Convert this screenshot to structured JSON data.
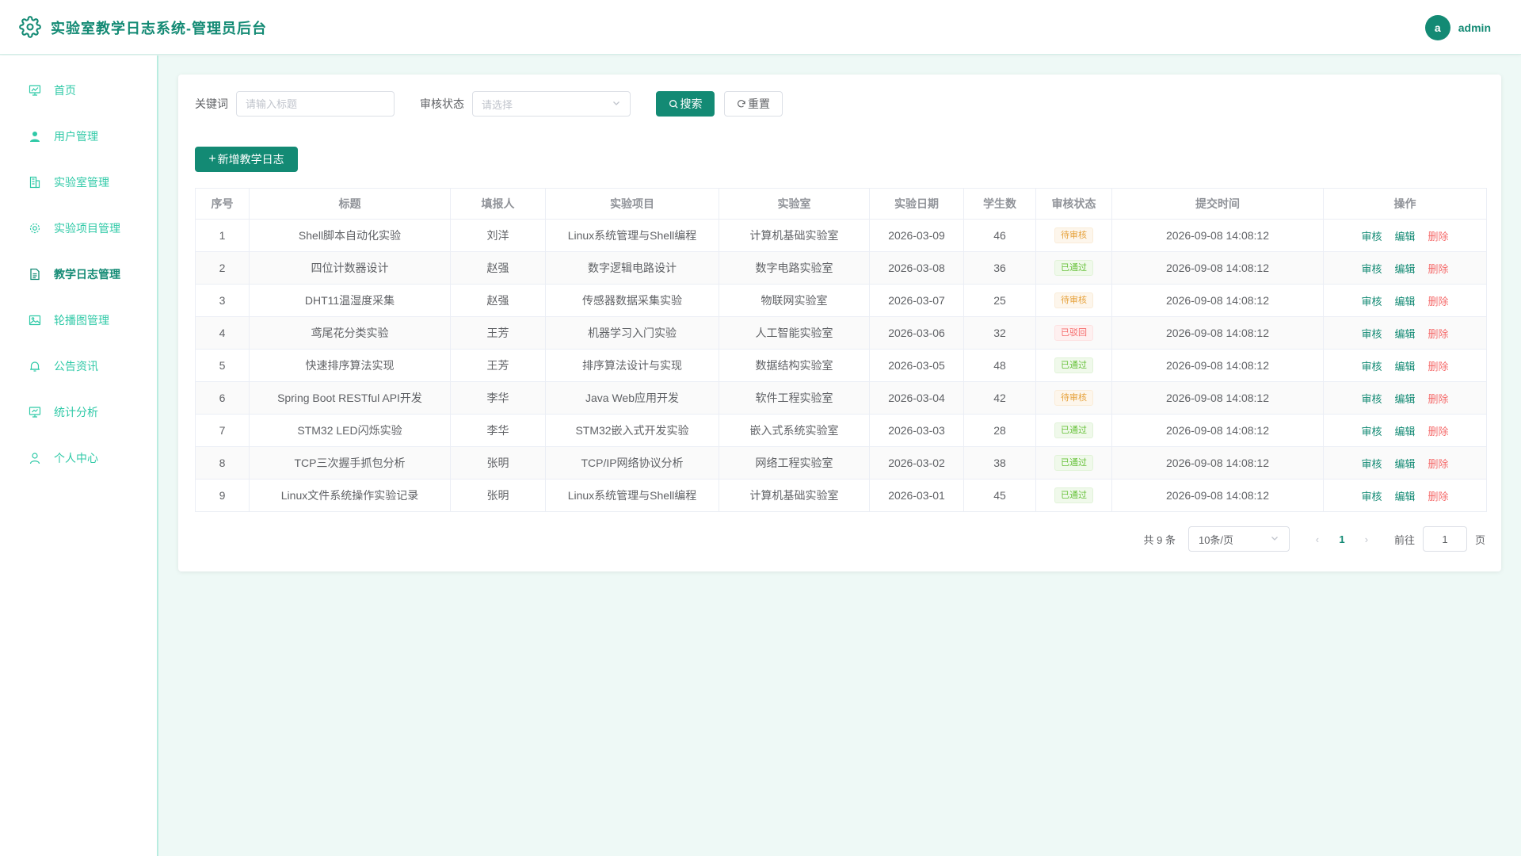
{
  "header": {
    "title": "实验室教学日志系统-管理员后台",
    "avatar_letter": "a",
    "username": "admin"
  },
  "sidebar": {
    "items": [
      {
        "label": "首页",
        "icon": "chart-icon",
        "active": false
      },
      {
        "label": "用户管理",
        "icon": "user-icon",
        "active": false
      },
      {
        "label": "实验室管理",
        "icon": "building-icon",
        "active": false
      },
      {
        "label": "实验项目管理",
        "icon": "gear-icon",
        "active": false
      },
      {
        "label": "教学日志管理",
        "icon": "document-icon",
        "active": true
      },
      {
        "label": "轮播图管理",
        "icon": "image-icon",
        "active": false
      },
      {
        "label": "公告资讯",
        "icon": "bell-icon",
        "active": false
      },
      {
        "label": "统计分析",
        "icon": "monitor-icon",
        "active": false
      },
      {
        "label": "个人中心",
        "icon": "person-icon",
        "active": false
      }
    ]
  },
  "search": {
    "keyword_label": "关键词",
    "keyword_placeholder": "请输入标题",
    "status_label": "审核状态",
    "status_placeholder": "请选择",
    "search_button": "搜索",
    "reset_button": "重置"
  },
  "add_button": "新增教学日志",
  "table": {
    "columns": [
      "序号",
      "标题",
      "填报人",
      "实验项目",
      "实验室",
      "实验日期",
      "学生数",
      "审核状态",
      "提交时间",
      "操作"
    ],
    "actions": {
      "review": "审核",
      "edit": "编辑",
      "delete": "删除"
    },
    "rows": [
      {
        "no": "1",
        "title": "Shell脚本自动化实验",
        "reporter": "刘洋",
        "project": "Linux系统管理与Shell编程",
        "lab": "计算机基础实验室",
        "date": "2026-03-09",
        "students": "46",
        "status": "待审核",
        "status_type": "pending",
        "submitted": "2026-09-08 14:08:12"
      },
      {
        "no": "2",
        "title": "四位计数器设计",
        "reporter": "赵强",
        "project": "数字逻辑电路设计",
        "lab": "数字电路实验室",
        "date": "2026-03-08",
        "students": "36",
        "status": "已通过",
        "status_type": "passed",
        "submitted": "2026-09-08 14:08:12"
      },
      {
        "no": "3",
        "title": "DHT11温湿度采集",
        "reporter": "赵强",
        "project": "传感器数据采集实验",
        "lab": "物联网实验室",
        "date": "2026-03-07",
        "students": "25",
        "status": "待审核",
        "status_type": "pending",
        "submitted": "2026-09-08 14:08:12"
      },
      {
        "no": "4",
        "title": "鸢尾花分类实验",
        "reporter": "王芳",
        "project": "机器学习入门实验",
        "lab": "人工智能实验室",
        "date": "2026-03-06",
        "students": "32",
        "status": "已驳回",
        "status_type": "rejected",
        "submitted": "2026-09-08 14:08:12"
      },
      {
        "no": "5",
        "title": "快速排序算法实现",
        "reporter": "王芳",
        "project": "排序算法设计与实现",
        "lab": "数据结构实验室",
        "date": "2026-03-05",
        "students": "48",
        "status": "已通过",
        "status_type": "passed",
        "submitted": "2026-09-08 14:08:12"
      },
      {
        "no": "6",
        "title": "Spring Boot RESTful API开发",
        "reporter": "李华",
        "project": "Java Web应用开发",
        "lab": "软件工程实验室",
        "date": "2026-03-04",
        "students": "42",
        "status": "待审核",
        "status_type": "pending",
        "submitted": "2026-09-08 14:08:12"
      },
      {
        "no": "7",
        "title": "STM32 LED闪烁实验",
        "reporter": "李华",
        "project": "STM32嵌入式开发实验",
        "lab": "嵌入式系统实验室",
        "date": "2026-03-03",
        "students": "28",
        "status": "已通过",
        "status_type": "passed",
        "submitted": "2026-09-08 14:08:12"
      },
      {
        "no": "8",
        "title": "TCP三次握手抓包分析",
        "reporter": "张明",
        "project": "TCP/IP网络协议分析",
        "lab": "网络工程实验室",
        "date": "2026-03-02",
        "students": "38",
        "status": "已通过",
        "status_type": "passed",
        "submitted": "2026-09-08 14:08:12"
      },
      {
        "no": "9",
        "title": "Linux文件系统操作实验记录",
        "reporter": "张明",
        "project": "Linux系统管理与Shell编程",
        "lab": "计算机基础实验室",
        "date": "2026-03-01",
        "students": "45",
        "status": "已通过",
        "status_type": "passed",
        "submitted": "2026-09-08 14:08:12"
      }
    ]
  },
  "pagination": {
    "total": "共 9 条",
    "page_size": "10条/页",
    "current_page": "1",
    "goto_label": "前往",
    "goto_value": "1",
    "page_suffix": "页"
  },
  "colors": {
    "primary": "#138a74",
    "accent": "#2fc9a7",
    "danger": "#f56c6c",
    "warning": "#e6a23c",
    "success": "#67c23a"
  }
}
